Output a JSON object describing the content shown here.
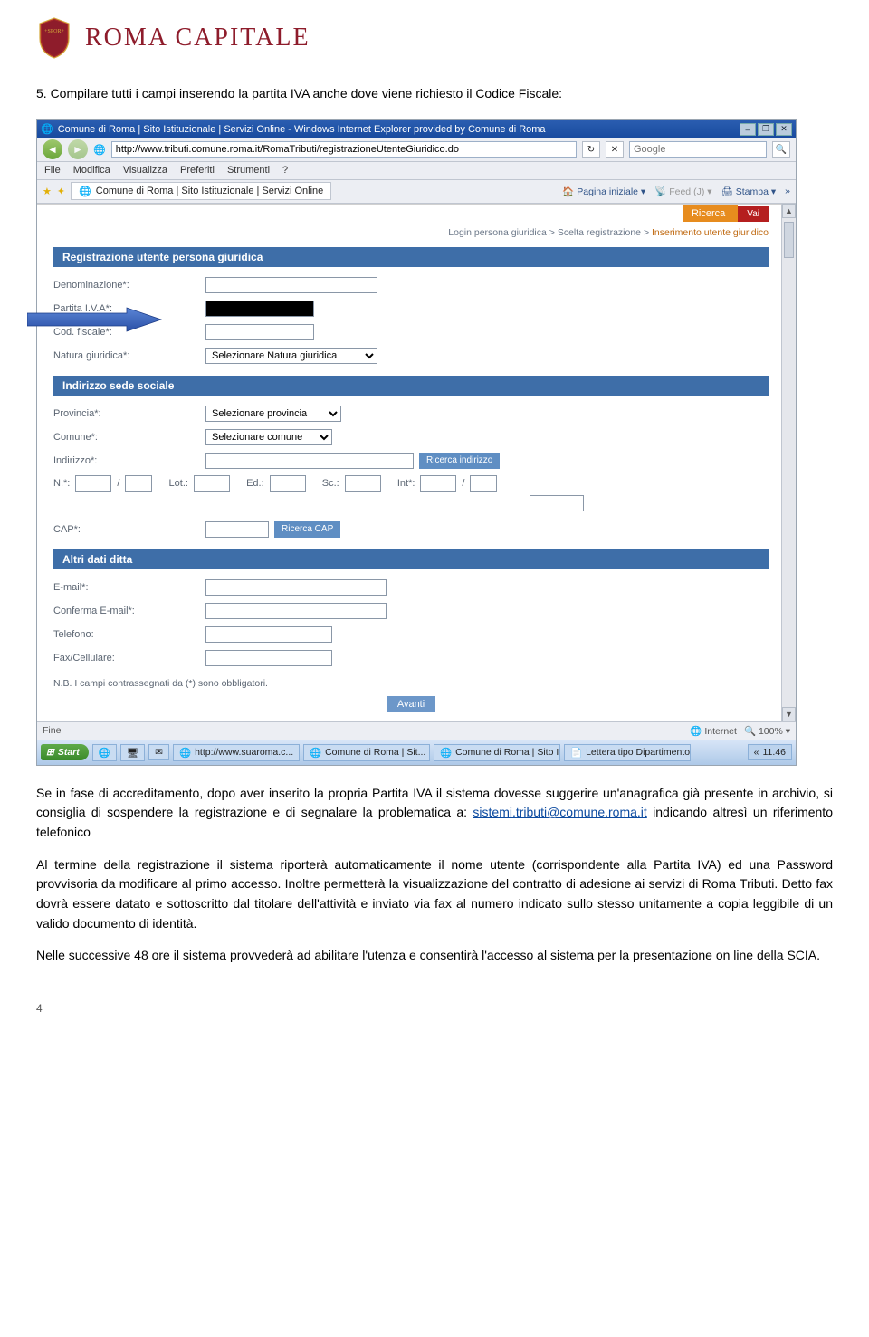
{
  "brand": {
    "text": "ROMA CAPITALE"
  },
  "doc": {
    "title": "5. Compilare tutti i campi inserendo la partita IVA anche dove viene richiesto il Codice Fiscale:",
    "p1_a": "Se in fase di accreditamento, dopo aver inserito la propria Partita IVA il sistema dovesse suggerire un'anagrafica già presente in archivio, si consiglia di sospendere la registrazione e di segnalare la problematica a: ",
    "email": "sistemi.tributi@comune.roma.it",
    "p1_b": " indicando altresì un riferimento telefonico",
    "p2": "Al termine della registrazione il sistema riporterà automaticamente il nome utente (corrispondente alla Partita IVA) ed una Password provvisoria da modificare al primo accesso. Inoltre permetterà la visualizzazione del contratto di adesione ai servizi di Roma Tributi. Detto fax dovrà essere datato e sottoscritto dal titolare dell'attività e inviato via fax al numero indicato sullo stesso unitamente a copia leggibile di un valido documento di identità.",
    "p3": "Nelle successive 48 ore il sistema provvederà ad abilitare l'utenza e consentirà l'accesso al sistema per la presentazione on line della SCIA.",
    "page_num": "4"
  },
  "browser": {
    "title": "Comune di Roma | Sito Istituzionale | Servizi Online - Windows Internet Explorer provided by Comune di Roma",
    "url": "http://www.tributi.comune.roma.it/RomaTributi/registrazioneUtenteGiuridico.do",
    "search_placeholder": "Google",
    "menus": [
      "File",
      "Modifica",
      "Visualizza",
      "Preferiti",
      "Strumenti",
      "?"
    ],
    "tab_label": "Comune di Roma | Sito Istituzionale | Servizi Online",
    "toolbtns": {
      "home": "Pagina iniziale",
      "feed": "Feed (J)",
      "print": "Stampa"
    },
    "orange": {
      "ricerca": "Ricerca",
      "vai": "Vai"
    },
    "breadcrumb": {
      "a": "Login persona giuridica",
      "b": "Scelta registrazione",
      "c": "Inserimento utente giuridico"
    },
    "status_left": "Fine",
    "status_internet": "Internet",
    "zoom": "100%"
  },
  "form": {
    "h1": "Registrazione utente persona giuridica",
    "denom": "Denominazione*:",
    "piva": "Partita I.V.A*:",
    "cf": "Cod. fiscale*:",
    "natura": "Natura giuridica*:",
    "natura_sel": "Selezionare Natura giuridica",
    "h2": "Indirizzo sede sociale",
    "provincia": "Provincia*:",
    "provincia_sel": "Selezionare provincia",
    "comune": "Comune*:",
    "comune_sel": "Selezionare comune",
    "indirizzo": "Indirizzo*:",
    "ricerca_ind": "Ricerca indirizzo",
    "num": {
      "n": "N.*:",
      "lot": "Lot.:",
      "ed": "Ed.:",
      "sc": "Sc.:",
      "int": "Int*:",
      "slash": "/"
    },
    "cap": "CAP*:",
    "ricerca_cap": "Ricerca CAP",
    "h3": "Altri dati ditta",
    "email": "E-mail*:",
    "email2": "Conferma E-mail*:",
    "tel": "Telefono:",
    "fax": "Fax/Cellulare:",
    "note": "N.B. I campi contrassegnati da (*) sono obbligatori.",
    "avanti": "Avanti"
  },
  "taskbar": {
    "start": "Start",
    "tasks": [
      "http://www.suaroma.c...",
      "Comune di Roma | Sit...",
      "Comune di Roma | Sito Is...",
      "Lettera tipo Dipartimento..."
    ],
    "clock": "11.46"
  }
}
